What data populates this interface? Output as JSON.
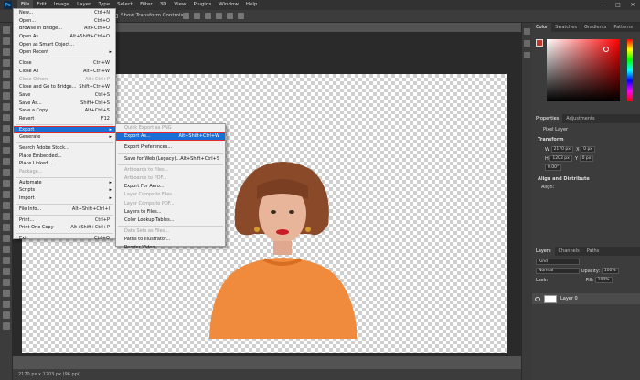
{
  "menubar": {
    "logo": "Ps",
    "items": [
      "File",
      "Edit",
      "Image",
      "Layer",
      "Type",
      "Select",
      "Filter",
      "3D",
      "View",
      "Plugins",
      "Window",
      "Help"
    ],
    "active": "File"
  },
  "options_bar": {
    "show_transform_controls": "Show Transform Controls"
  },
  "document_tab": "",
  "status_bar": "2170 px x 1203 px (96 ppi)",
  "file_menu": [
    {
      "label": "New...",
      "shortcut": "Ctrl+N"
    },
    {
      "label": "Open...",
      "shortcut": "Ctrl+O"
    },
    {
      "label": "Browse in Bridge...",
      "shortcut": "Alt+Ctrl+O"
    },
    {
      "label": "Open As...",
      "shortcut": "Alt+Shift+Ctrl+O"
    },
    {
      "label": "Open as Smart Object...",
      "shortcut": ""
    },
    {
      "label": "Open Recent",
      "shortcut": "",
      "submenu": true
    },
    {
      "sep": true
    },
    {
      "label": "Close",
      "shortcut": "Ctrl+W"
    },
    {
      "label": "Close All",
      "shortcut": "Alt+Ctrl+W"
    },
    {
      "label": "Close Others",
      "shortcut": "Alt+Ctrl+P",
      "disabled": true
    },
    {
      "label": "Close and Go to Bridge...",
      "shortcut": "Shift+Ctrl+W"
    },
    {
      "label": "Save",
      "shortcut": "Ctrl+S"
    },
    {
      "label": "Save As...",
      "shortcut": "Shift+Ctrl+S"
    },
    {
      "label": "Save a Copy...",
      "shortcut": "Alt+Ctrl+S"
    },
    {
      "label": "Revert",
      "shortcut": "F12"
    },
    {
      "sep": true
    },
    {
      "label": "Export",
      "shortcut": "",
      "submenu": true,
      "selected": true
    },
    {
      "label": "Generate",
      "shortcut": "",
      "submenu": true
    },
    {
      "sep": true
    },
    {
      "label": "Search Adobe Stock...",
      "shortcut": ""
    },
    {
      "label": "Place Embedded...",
      "shortcut": ""
    },
    {
      "label": "Place Linked...",
      "shortcut": ""
    },
    {
      "label": "Package...",
      "shortcut": "",
      "disabled": true
    },
    {
      "sep": true
    },
    {
      "label": "Automate",
      "shortcut": "",
      "submenu": true
    },
    {
      "label": "Scripts",
      "shortcut": "",
      "submenu": true
    },
    {
      "label": "Import",
      "shortcut": "",
      "submenu": true
    },
    {
      "sep": true
    },
    {
      "label": "File Info...",
      "shortcut": "Alt+Shift+Ctrl+I"
    },
    {
      "sep": true
    },
    {
      "label": "Print...",
      "shortcut": "Ctrl+P"
    },
    {
      "label": "Print One Copy",
      "shortcut": "Alt+Shift+Ctrl+P"
    },
    {
      "sep": true
    },
    {
      "label": "Exit",
      "shortcut": "Ctrl+Q"
    }
  ],
  "export_submenu": [
    {
      "label": "Quick Export as PNG",
      "shortcut": "",
      "disabled": true
    },
    {
      "label": "Export As...",
      "shortcut": "Alt+Shift+Ctrl+W",
      "selected": true
    },
    {
      "sep": true
    },
    {
      "label": "Export Preferences...",
      "shortcut": ""
    },
    {
      "sep": true
    },
    {
      "label": "Save for Web (Legacy)...",
      "shortcut": "Alt+Shift+Ctrl+S"
    },
    {
      "sep": true
    },
    {
      "label": "Artboards to Files...",
      "shortcut": "",
      "disabled": true
    },
    {
      "label": "Artboards to PDF...",
      "shortcut": "",
      "disabled": true
    },
    {
      "label": "Export For Aero...",
      "shortcut": ""
    },
    {
      "label": "Layer Comps to Files...",
      "shortcut": "",
      "disabled": true
    },
    {
      "label": "Layer Comps to PDF...",
      "shortcut": "",
      "disabled": true
    },
    {
      "label": "Layers to Files...",
      "shortcut": ""
    },
    {
      "label": "Color Lookup Tables...",
      "shortcut": ""
    },
    {
      "sep": true
    },
    {
      "label": "Data Sets as Files...",
      "shortcut": "",
      "disabled": true
    },
    {
      "label": "Paths to Illustrator...",
      "shortcut": ""
    },
    {
      "label": "Render Video...",
      "shortcut": ""
    }
  ],
  "color_panel": {
    "tabs": [
      "Color",
      "Swatches",
      "Gradients",
      "Patterns"
    ],
    "foreground": "#c0392b"
  },
  "properties_panel": {
    "tabs": [
      "Properties",
      "Adjustments"
    ],
    "pixel_layer": "Pixel Layer",
    "transform_title": "Transform",
    "w": "2170 px",
    "h": "1203 px",
    "x": "0 px",
    "y": "0 px",
    "angle": "0.00°",
    "align_title": "Align and Distribute",
    "align_label": "Align:"
  },
  "layers_panel": {
    "tabs": [
      "Layers",
      "Channels",
      "Paths"
    ],
    "kind": "Kind",
    "blend": "Normal",
    "opacity_label": "Opacity:",
    "opacity": "100%",
    "lock_label": "Lock:",
    "fill_label": "Fill:",
    "fill": "100%",
    "layer_name": "Layer 0"
  }
}
